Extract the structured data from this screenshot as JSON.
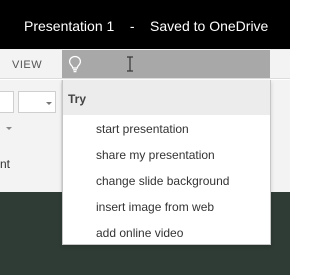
{
  "window": {
    "title": "Presentation 1    -    Saved to OneDrive"
  },
  "menubar": {
    "view_tab": "VIEW"
  },
  "tell_me": {
    "icon": "lightbulb-icon",
    "cursor": "ibeam-cursor"
  },
  "ribbon": {
    "partial_label": "nt"
  },
  "dropdown": {
    "header": "Try",
    "items": [
      "start presentation",
      "share my presentation",
      "change slide background",
      "insert image from web",
      "add online video"
    ]
  },
  "colors": {
    "titlebar": "#000000",
    "search_box": "#a8a8a8",
    "slide_background": "#2f3b35"
  }
}
